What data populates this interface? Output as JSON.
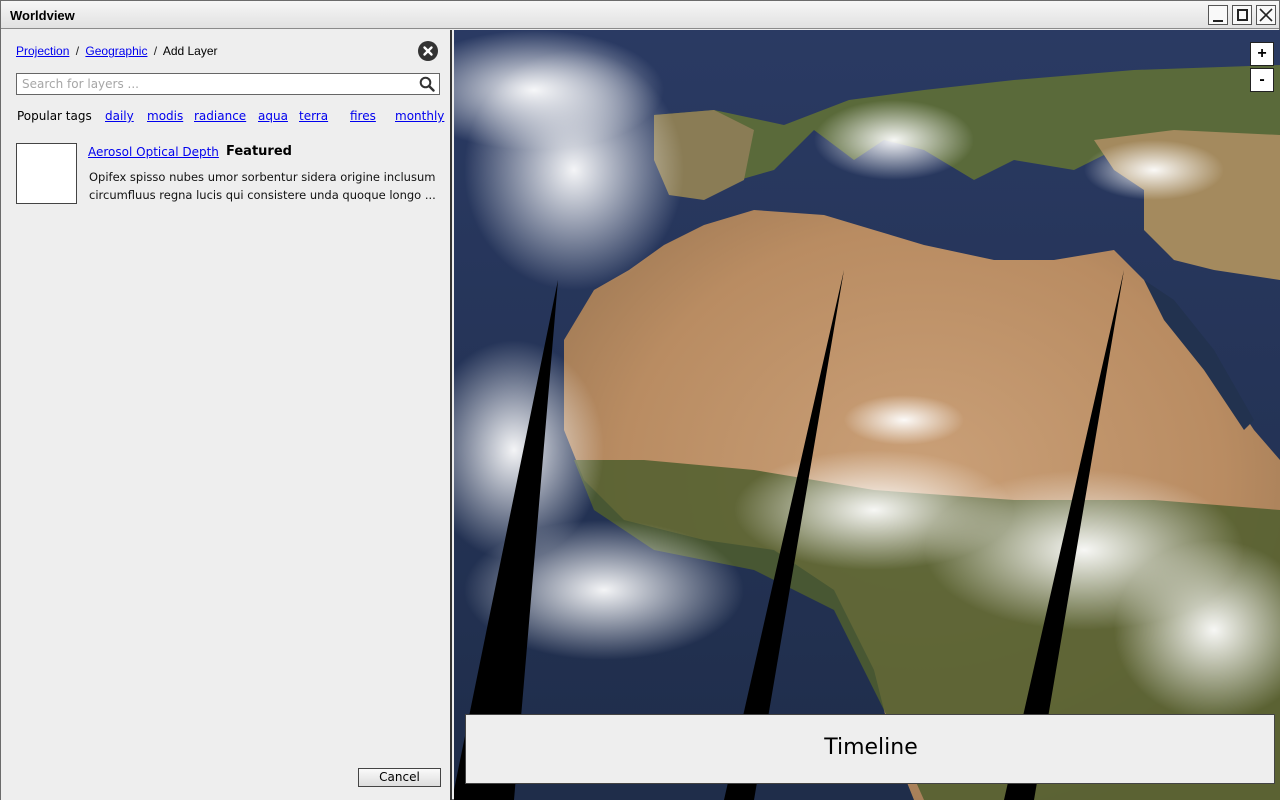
{
  "window": {
    "title": "Worldview",
    "controls": [
      "minimize-icon",
      "maximize-icon",
      "close-icon"
    ]
  },
  "panel": {
    "breadcrumb": {
      "items": [
        "Projection",
        "Geographic"
      ],
      "separator": "/",
      "current": "Add Layer"
    },
    "search": {
      "placeholder": "Search for layers ..."
    },
    "popular_tags": {
      "label": "Popular tags",
      "tags": [
        "daily",
        "modis",
        "radiance",
        "aqua",
        "terra",
        "fires",
        "monthly"
      ]
    },
    "layers": [
      {
        "name": "Aerosol Optical Depth",
        "badge": "Featured",
        "description": "Opifex spisso nubes umor sorbentur sidera origine inclusum circumfluus regna lucis qui consistere unda quoque longo ..."
      }
    ],
    "cancel_label": "Cancel"
  },
  "map": {
    "zoom_in_label": "+",
    "zoom_out_label": "-",
    "timeline_label": "Timeline"
  },
  "colors": {
    "link": "#0000ee",
    "panel_bg": "#eeeeee",
    "ocean": "#1c2a4e",
    "desert": "#c4986b",
    "vegetation": "#4f5e2e"
  }
}
